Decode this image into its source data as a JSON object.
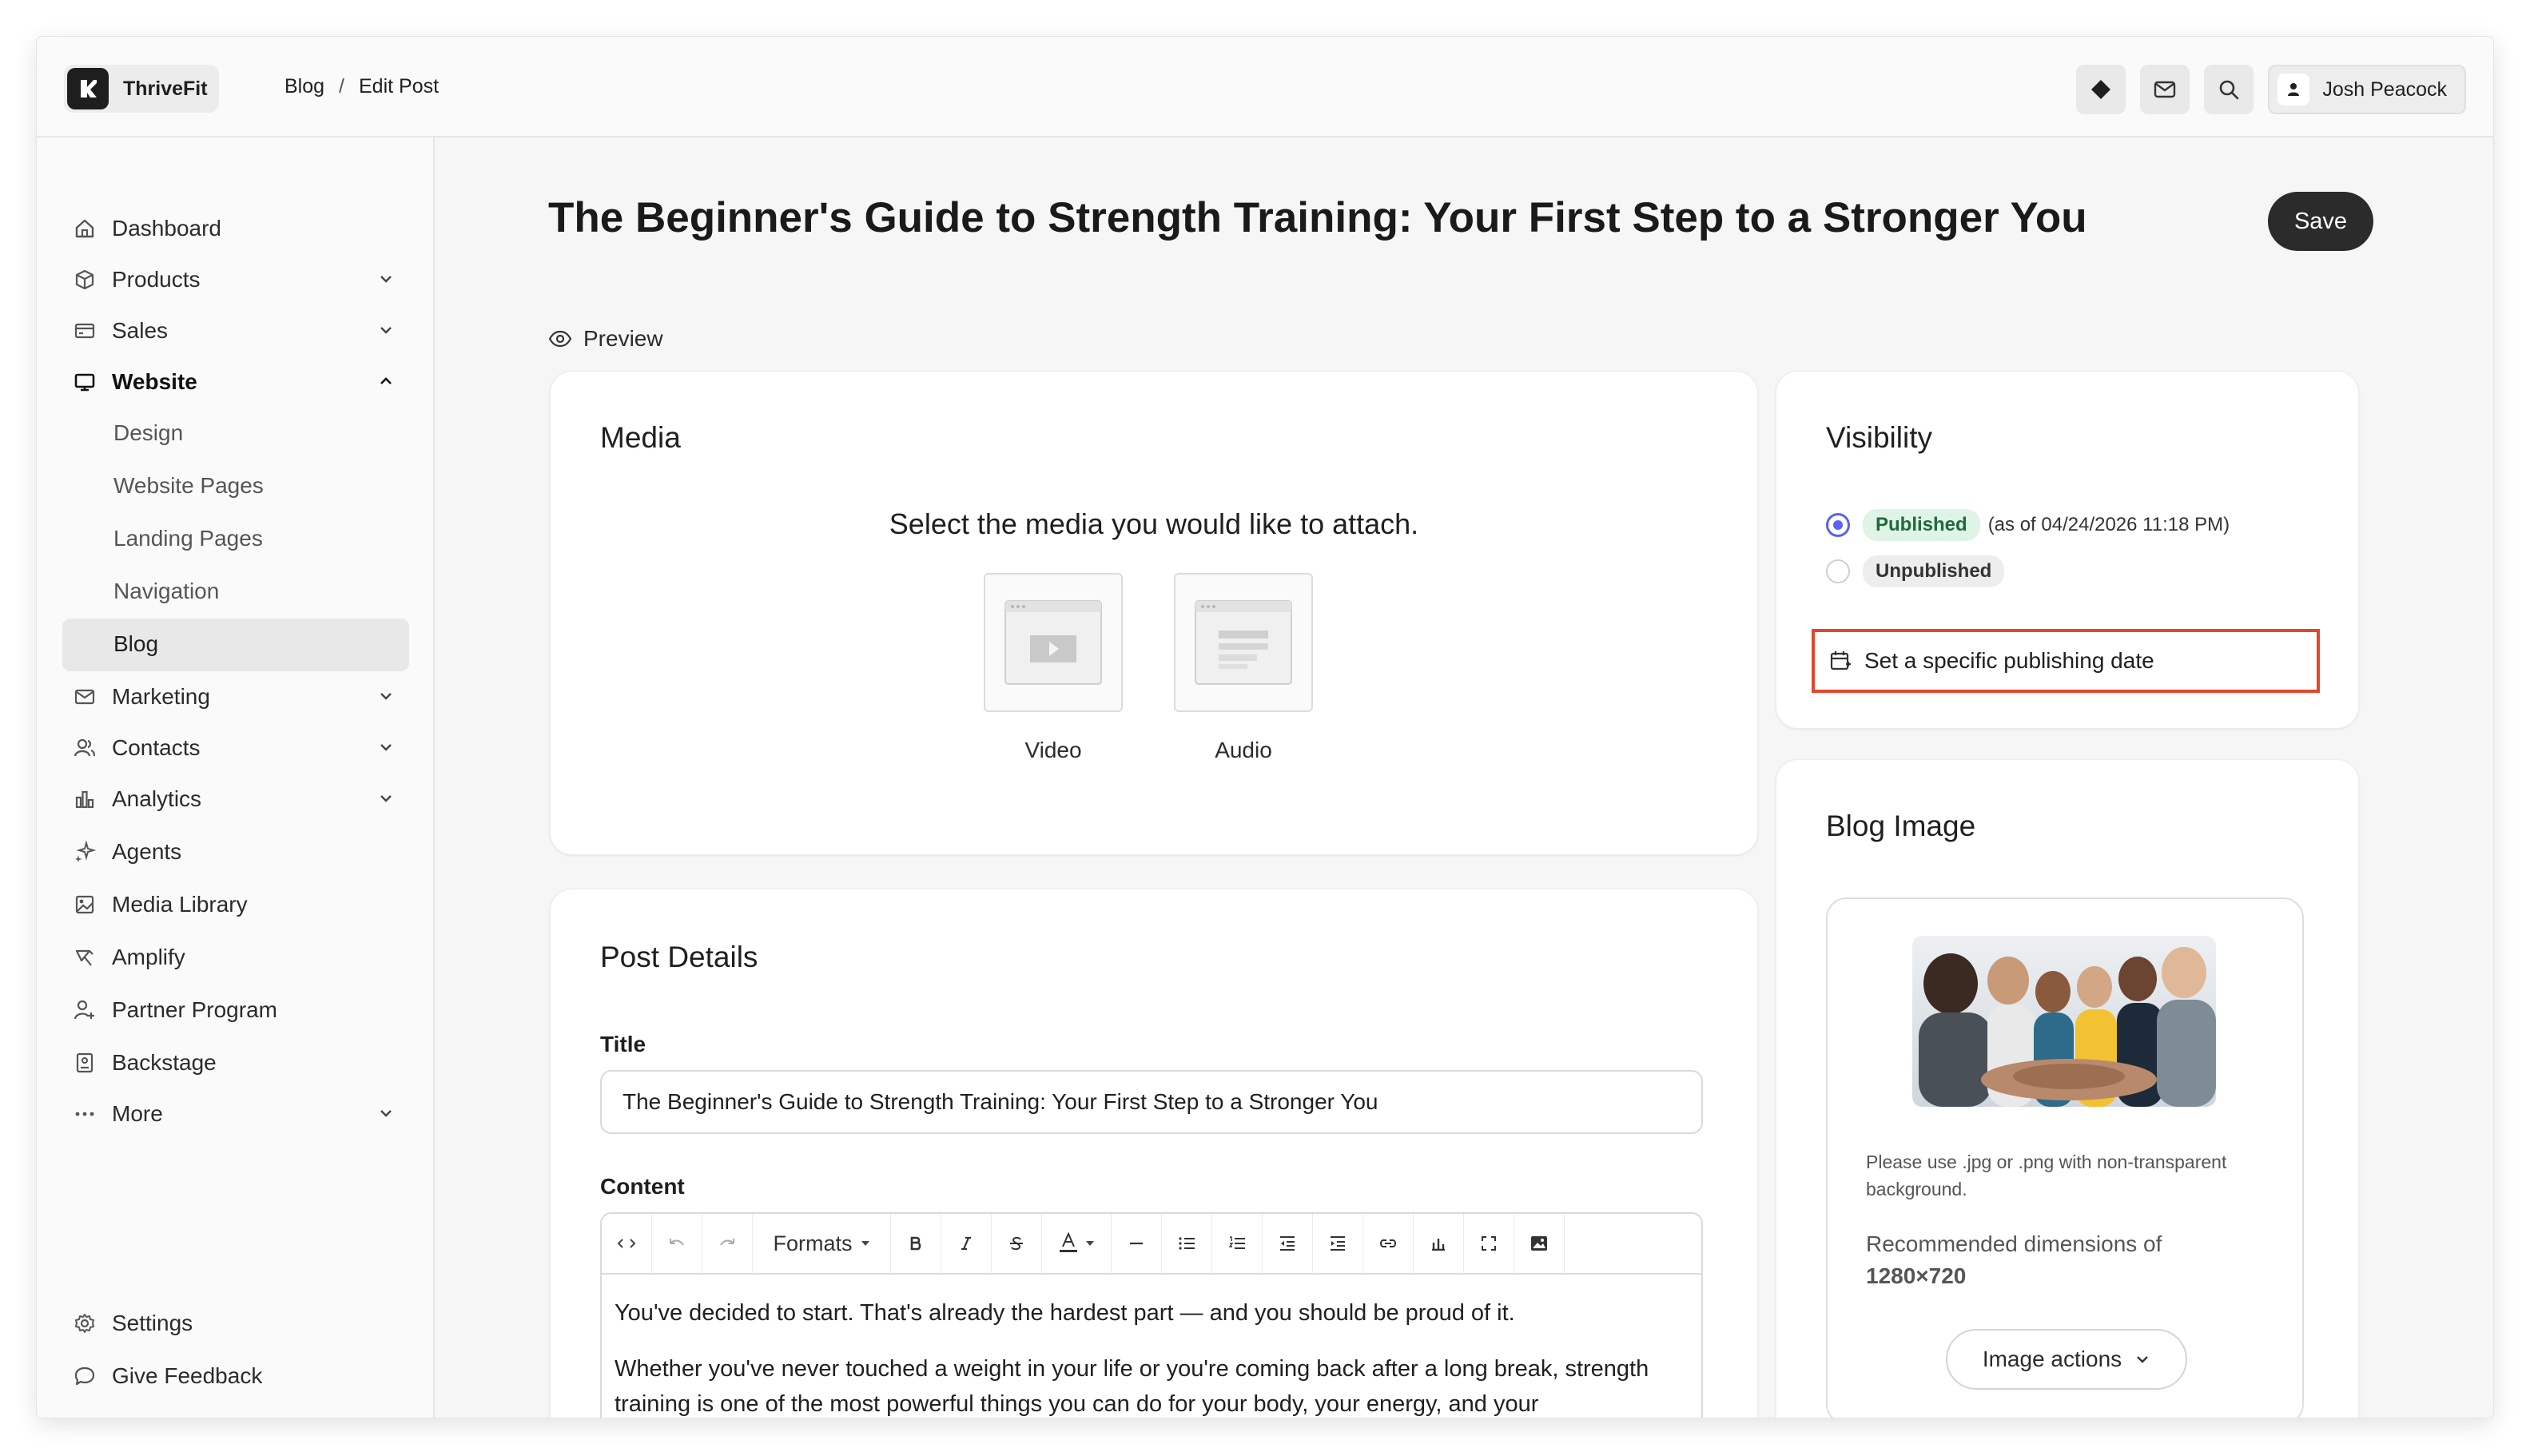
{
  "app": {
    "name": "ThriveFit"
  },
  "breadcrumb": {
    "items": [
      "Blog",
      "Edit Post"
    ],
    "separator": "/"
  },
  "header": {
    "user_name": "Josh Peacock"
  },
  "sidebar": {
    "items": [
      {
        "label": "Dashboard"
      },
      {
        "label": "Products"
      },
      {
        "label": "Sales"
      },
      {
        "label": "Website"
      },
      {
        "label": "Design"
      },
      {
        "label": "Website Pages"
      },
      {
        "label": "Landing Pages"
      },
      {
        "label": "Navigation"
      },
      {
        "label": "Blog"
      },
      {
        "label": "Marketing"
      },
      {
        "label": "Contacts"
      },
      {
        "label": "Analytics"
      },
      {
        "label": "Agents"
      },
      {
        "label": "Media Library"
      },
      {
        "label": "Amplify"
      },
      {
        "label": "Partner Program"
      },
      {
        "label": "Backstage"
      },
      {
        "label": "More"
      }
    ],
    "footer": [
      {
        "label": "Settings"
      },
      {
        "label": "Give Feedback"
      }
    ]
  },
  "page": {
    "title": "The Beginner's Guide to Strength Training: Your First Step to a Stronger You",
    "save_label": "Save",
    "preview_label": "Preview"
  },
  "media": {
    "title": "Media",
    "prompt": "Select the media you would like to attach.",
    "options": [
      {
        "label": "Video"
      },
      {
        "label": "Audio"
      }
    ]
  },
  "post_details": {
    "title": "Post Details",
    "title_label": "Title",
    "title_value": "The Beginner's Guide to Strength Training: Your First Step to a Stronger You",
    "content_label": "Content",
    "toolbar": {
      "formats_label": "Formats"
    },
    "content_paragraphs": [
      "You've decided to start. That's already the hardest part — and you should be proud of it.",
      "Whether you've never touched a weight in your life or you're coming back after a long break, strength training is one of the most powerful things you can do for your body, your energy, and your"
    ]
  },
  "visibility": {
    "title": "Visibility",
    "published_label": "Published",
    "published_note": "(as of 04/24/2026 11:18 PM)",
    "unpublished_label": "Unpublished",
    "selected": "Published",
    "schedule_label": "Set a specific publishing date"
  },
  "blog_image": {
    "title": "Blog Image",
    "hint": "Please use .jpg or .png with non-transparent background.",
    "dims_prefix": "Recommended dimensions of",
    "dims_value": "1280×720",
    "actions_label": "Image actions"
  },
  "colors": {
    "accent_radio": "#5b61f0",
    "published_pill_bg": "#dff3e6",
    "highlight_border": "#e0482d",
    "save_button_bg": "#2b2b2b"
  }
}
